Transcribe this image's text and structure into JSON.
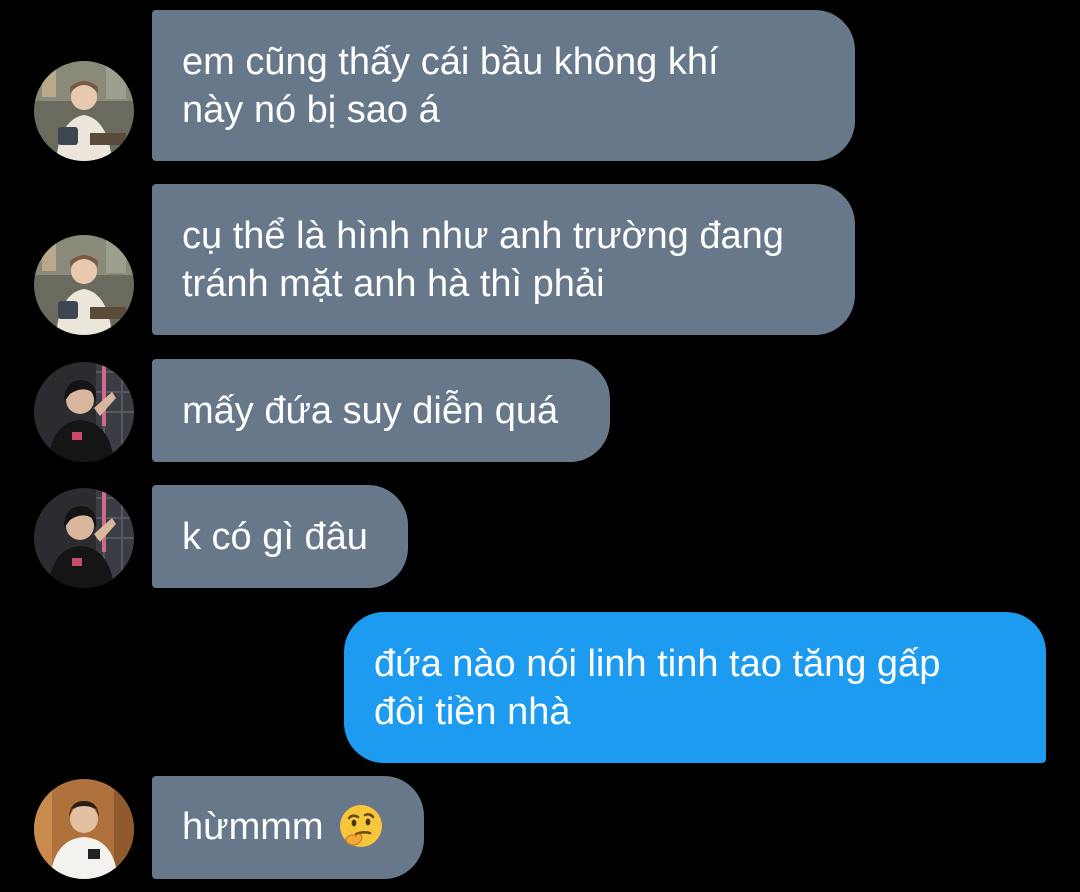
{
  "colors": {
    "background": "#000000",
    "incoming_bubble": "#67788a",
    "outgoing_bubble": "#1d9bf0",
    "text": "#ffffff"
  },
  "messages": [
    {
      "direction": "incoming",
      "avatar_icon": "avatar-icon",
      "lines": [
        "em cũng thấy cái bầu không khí",
        "này nó bị sao á"
      ]
    },
    {
      "direction": "incoming",
      "avatar_icon": "avatar-icon",
      "lines": [
        "cụ thể là hình như anh trường đang",
        "tránh mặt anh hà thì phải"
      ]
    },
    {
      "direction": "incoming",
      "avatar_icon": "avatar-icon",
      "lines": [
        "mấy đứa suy diễn quá"
      ]
    },
    {
      "direction": "incoming",
      "avatar_icon": "avatar-icon",
      "lines": [
        "k có gì đâu"
      ]
    },
    {
      "direction": "outgoing",
      "lines": [
        "đứa nào nói linh tinh tao tăng gấp",
        "đôi tiền nhà"
      ]
    },
    {
      "direction": "incoming",
      "avatar_icon": "avatar-icon",
      "lines": [
        "hừmmm"
      ],
      "emoji": "thinking-face-emoji"
    }
  ]
}
